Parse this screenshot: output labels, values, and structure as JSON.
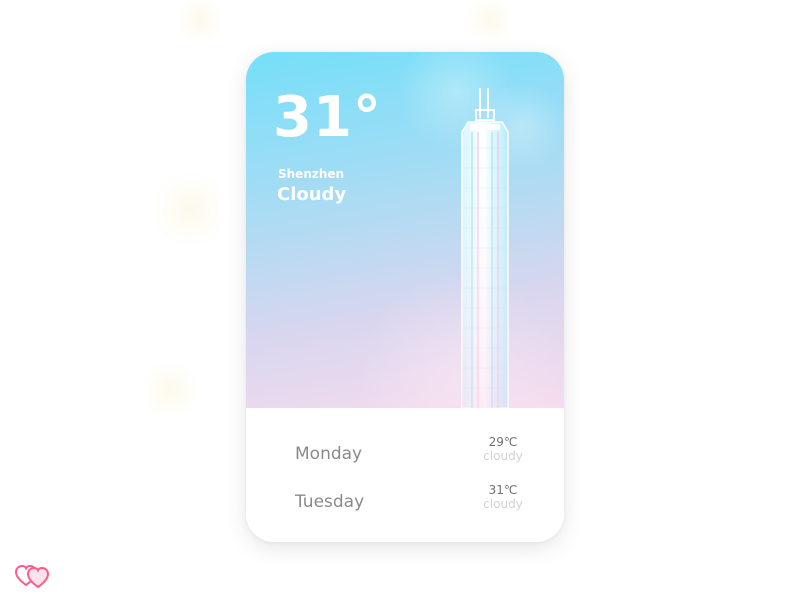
{
  "weather": {
    "temperature": "31°",
    "city": "Shenzhen",
    "condition": "Cloudy"
  },
  "forecast": [
    {
      "day": "Monday",
      "temp": "29℃",
      "condition": "cloudy"
    },
    {
      "day": "Tuesday",
      "temp": "31℃",
      "condition": "cloudy"
    }
  ],
  "colors": {
    "sky_top": "#74dff9",
    "sky_bottom": "#f6dcee",
    "day_text": "#8a8a8a",
    "condition_text": "#d2d2d2",
    "logo_pink": "#ff5c8a"
  },
  "icons": {
    "illustration": "skyscraper-illustration",
    "logo": "double-heart-logo"
  }
}
